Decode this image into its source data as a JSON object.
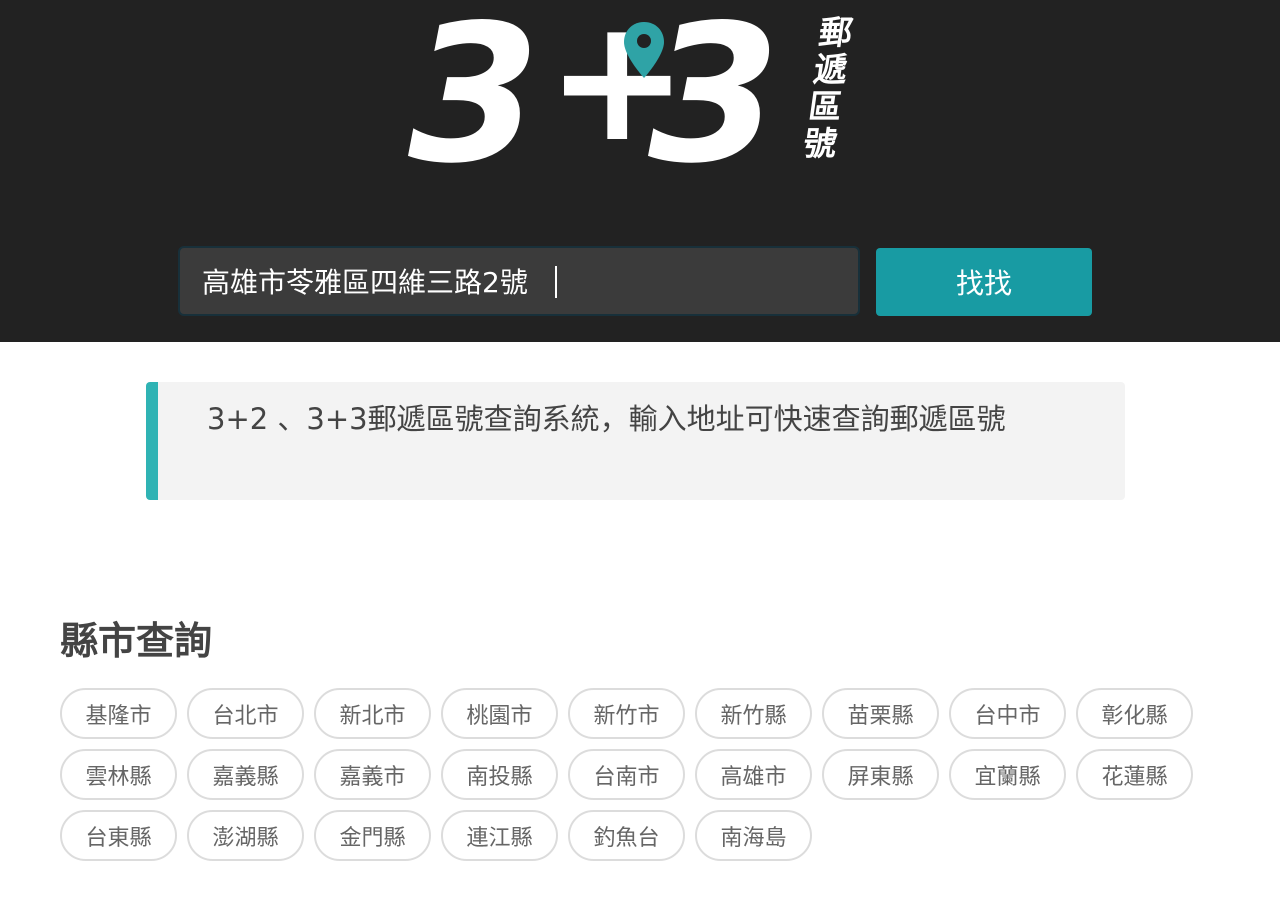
{
  "logo": {
    "number_left": "3",
    "plus": "+",
    "number_right": "3",
    "side_text": "郵遞區號"
  },
  "search": {
    "value": "高雄市苓雅區四維三路2號",
    "button_label": "找找"
  },
  "notice": {
    "text": "3+2 、3+3郵遞區號查詢系統，輸入地址可快速查詢郵遞區號"
  },
  "cities": {
    "title": "縣市查詢",
    "items": [
      "基隆市",
      "台北市",
      "新北市",
      "桃園市",
      "新竹市",
      "新竹縣",
      "苗栗縣",
      "台中市",
      "彰化縣",
      "雲林縣",
      "嘉義縣",
      "嘉義市",
      "南投縣",
      "台南市",
      "高雄市",
      "屏東縣",
      "宜蘭縣",
      "花蓮縣",
      "台東縣",
      "澎湖縣",
      "金門縣",
      "連江縣",
      "釣魚台",
      "南海島"
    ]
  },
  "colors": {
    "header_bg": "#222222",
    "accent": "#189ba3",
    "pin": "#2fa3a6",
    "notice_bar": "#2fb3b4"
  },
  "icons": {
    "logo_pin": "map-pin-icon"
  }
}
